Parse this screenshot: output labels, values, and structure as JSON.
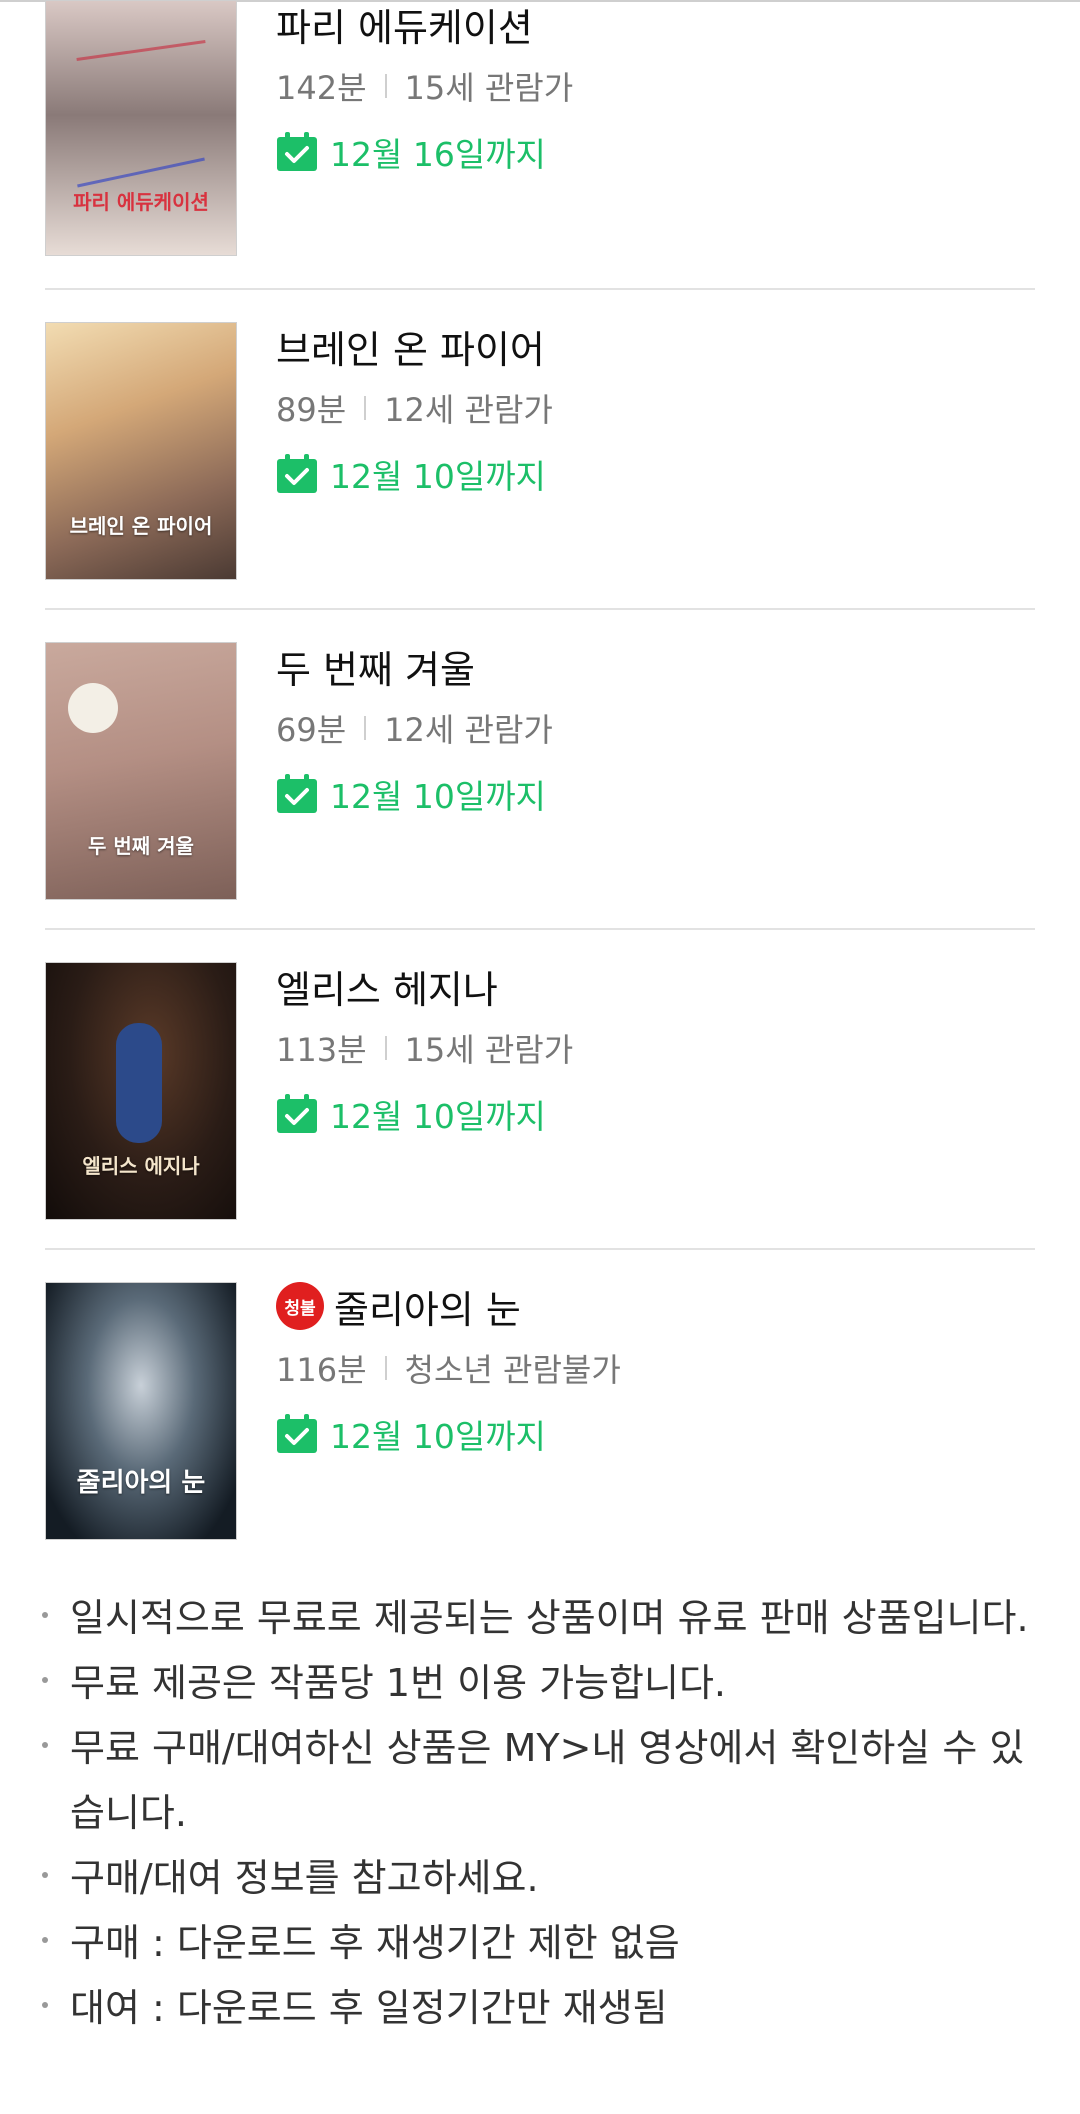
{
  "movies": [
    {
      "title": "파리 에듀케이션",
      "duration": "142분",
      "rating": "15세 관람가",
      "available_until": "12월 16일까지",
      "poster_title": "파리 에듀케이션",
      "poster_colors": [
        "#d8c6c2",
        "#7b6b6b"
      ],
      "restricted": false
    },
    {
      "title": "브레인 온 파이어",
      "duration": "89분",
      "rating": "12세 관람가",
      "available_until": "12월 10일까지",
      "poster_title": "브레인 온 파이어",
      "poster_colors": [
        "#e9cfa3",
        "#6b4a3a"
      ],
      "restricted": false
    },
    {
      "title": "두 번째 겨울",
      "duration": "69분",
      "rating": "12세 관람가",
      "available_until": "12월 10일까지",
      "poster_title": "두 번째 겨울",
      "poster_colors": [
        "#c8a79b",
        "#5e4a44"
      ],
      "restricted": false
    },
    {
      "title": "엘리스 헤지나",
      "duration": "113분",
      "rating": "15세 관람가",
      "available_until": "12월 10일까지",
      "poster_title": "엘리스 에지나",
      "poster_colors": [
        "#1e1613",
        "#4a3324"
      ],
      "restricted": false
    },
    {
      "title": "줄리아의 눈",
      "duration": "116분",
      "rating": "청소년 관람불가",
      "available_until": "12월 10일까지",
      "poster_title": "줄리아의 눈",
      "poster_colors": [
        "#1b2530",
        "#708090"
      ],
      "restricted": true,
      "badge_label": "청불"
    }
  ],
  "notes": [
    "일시적으로 무료로 제공되는 상품이며 유료 판매 상품입니다.",
    "무료 제공은 작품당 1번 이용 가능합니다.",
    "무료 구매/대여하신 상품은 MY>내 영상에서 확인하실 수 있습니다.",
    "구매/대여 정보를 참고하세요.",
    "구매 : 다운로드 후 재생기간 제한 없음",
    "대여 : 다운로드 후 일정기간만 재생됨"
  ],
  "colors": {
    "accent_green": "#1cbf68",
    "restricted_red": "#e01f1f"
  }
}
